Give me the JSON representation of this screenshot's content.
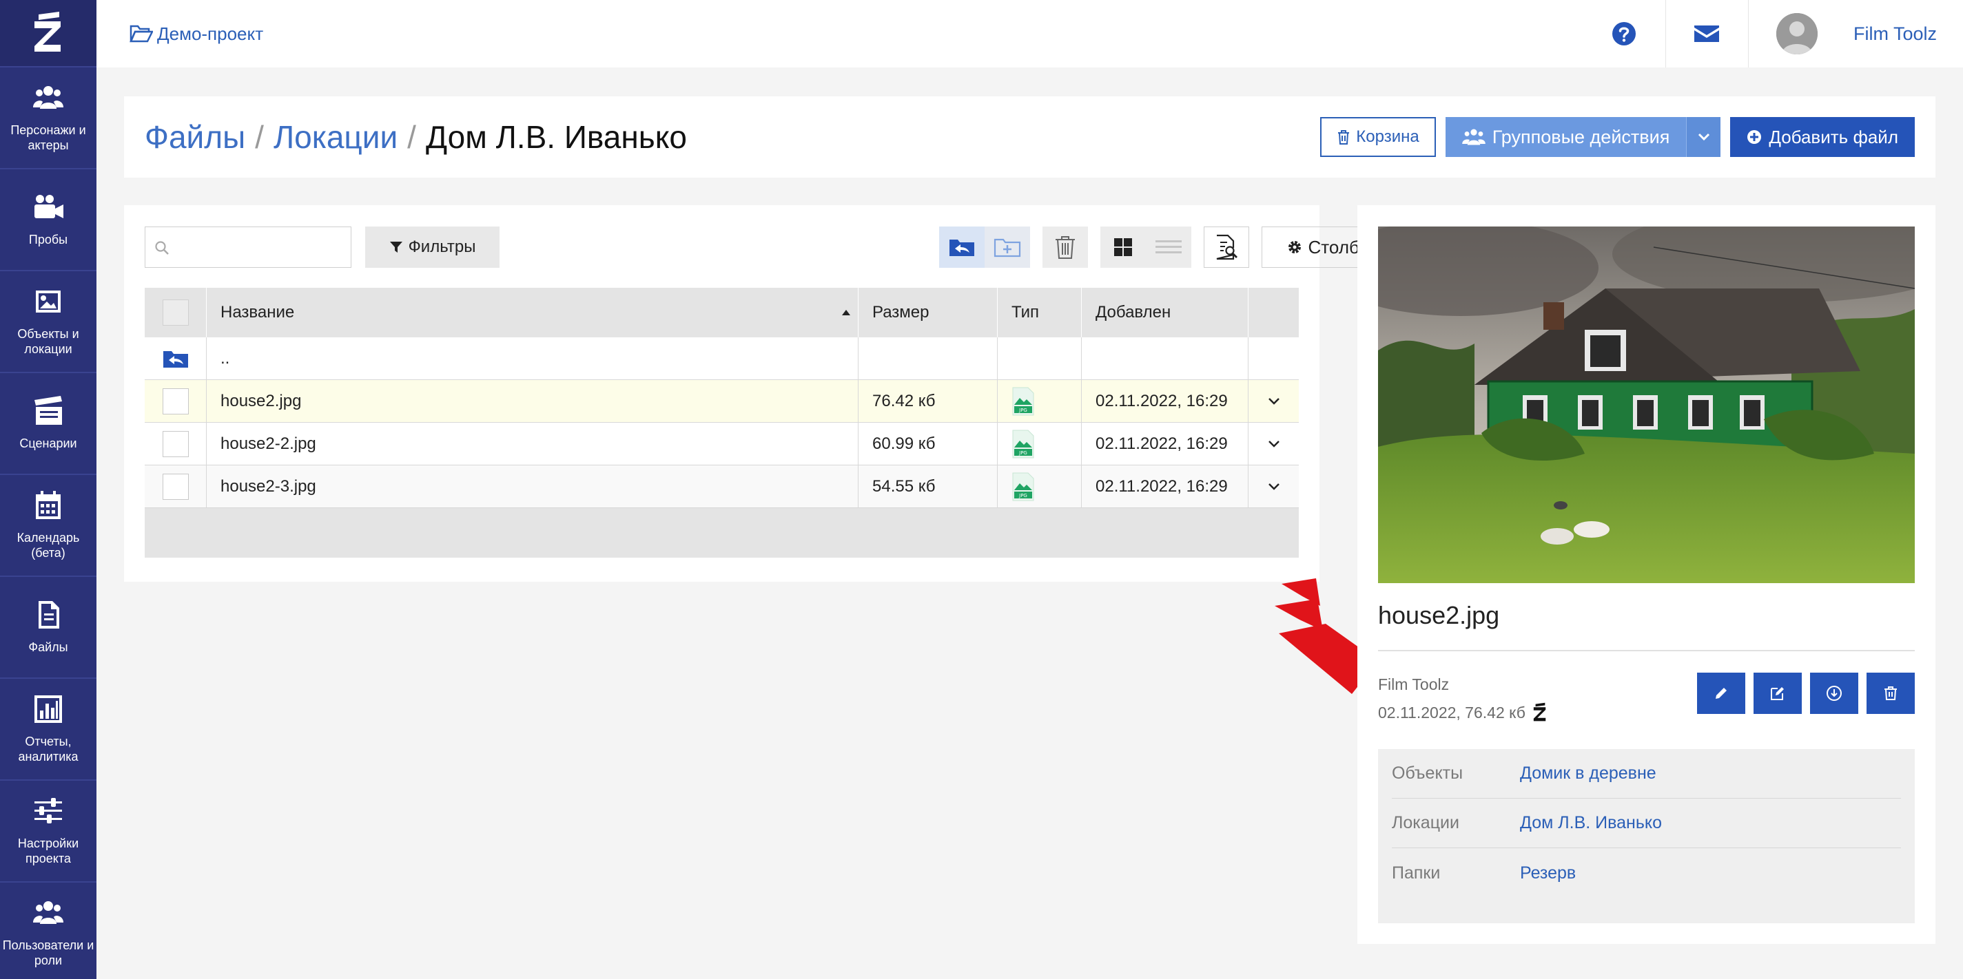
{
  "sidebar": {
    "items": [
      {
        "label": "Персонажи и актеры",
        "icon": "people-icon"
      },
      {
        "label": "Пробы",
        "icon": "video-camera-icon"
      },
      {
        "label": "Объекты и локации",
        "icon": "image-icon"
      },
      {
        "label": "Сценарии",
        "icon": "clapperboard-icon"
      },
      {
        "label": "Календарь (бета)",
        "icon": "calendar-icon"
      },
      {
        "label": "Файлы",
        "icon": "file-icon"
      },
      {
        "label": "Отчеты, аналитика",
        "icon": "bar-chart-icon"
      },
      {
        "label": "Настройки проекта",
        "icon": "sliders-icon"
      },
      {
        "label": "Пользователи и роли",
        "icon": "users-icon"
      }
    ]
  },
  "header": {
    "project": "Демо-проект",
    "user": "Film Toolz"
  },
  "breadcrumb": {
    "root": "Файлы",
    "section": "Локации",
    "current": "Дом Л.В. Иванько",
    "separator": "/"
  },
  "actions": {
    "trash": "Корзина",
    "group": "Групповые действия",
    "add": "Добавить файл"
  },
  "toolbar": {
    "search_placeholder": "",
    "filters": "Фильтры",
    "columns": "Столбцы"
  },
  "table": {
    "headers": {
      "name": "Название",
      "size": "Размер",
      "type": "Тип",
      "added": "Добавлен"
    },
    "up_label": "..",
    "rows": [
      {
        "name": "house2.jpg",
        "size": "76.42 кб",
        "type": "JPG",
        "added": "02.11.2022, 16:29"
      },
      {
        "name": "house2-2.jpg",
        "size": "60.99 кб",
        "type": "JPG",
        "added": "02.11.2022, 16:29"
      },
      {
        "name": "house2-3.jpg",
        "size": "54.55 кб",
        "type": "JPG",
        "added": "02.11.2022, 16:29"
      }
    ]
  },
  "preview": {
    "filename": "house2.jpg",
    "author": "Film Toolz",
    "meta": "02.11.2022, 76.42 кб",
    "props": [
      {
        "key": "Объекты",
        "value": "Домик в деревне"
      },
      {
        "key": "Локации",
        "value": "Дом Л.В. Иванько"
      },
      {
        "key": "Папки",
        "value": "Резерв"
      }
    ]
  },
  "colors": {
    "sidebar": "#2b3278",
    "primary": "#2554b8",
    "link": "#2b5fb7",
    "group_button": "#6b99e0",
    "highlight_row": "#fdfde8"
  }
}
